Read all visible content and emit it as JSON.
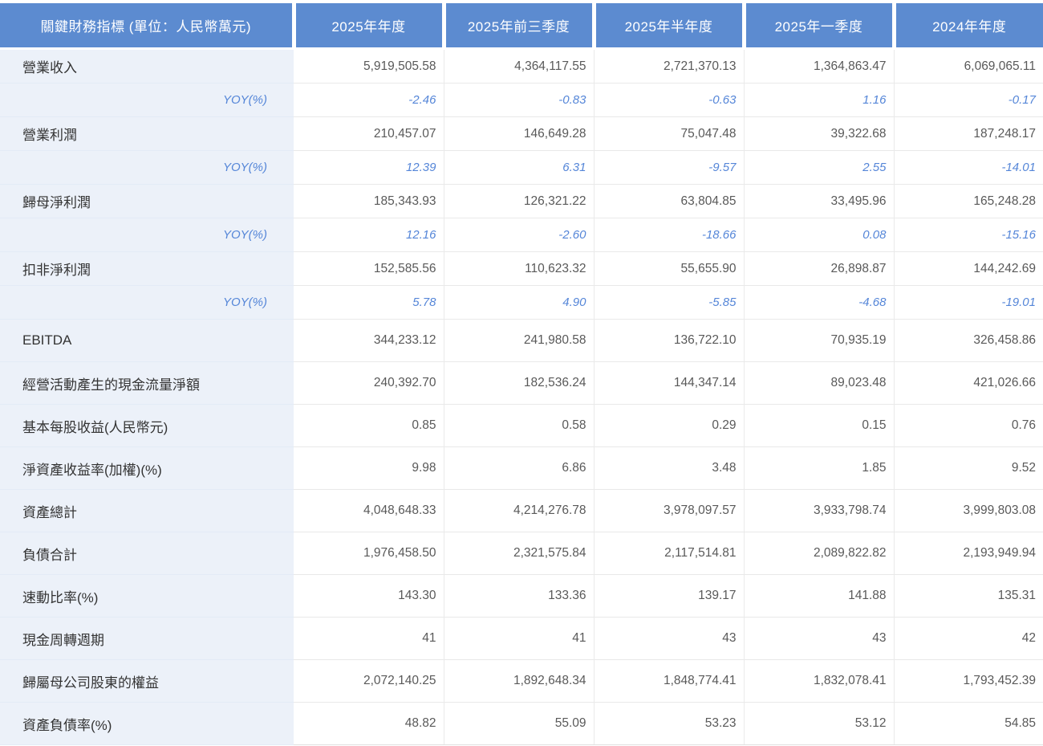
{
  "colors": {
    "header_bg": "#5C8BD0",
    "header_text": "#FFFFFF",
    "label_column_bg": "#ECF1F9",
    "label_text": "#333333",
    "value_text": "#595959",
    "yoy_text": "#5586D8",
    "grid_line": "#E9E9E9"
  },
  "chart_data": {
    "type": "table",
    "title": "關鍵財務指標 (單位：人民幣萬元)",
    "columns": [
      "2025年年度",
      "2025年前三季度",
      "2025年半年度",
      "2025年一季度",
      "2024年年度"
    ],
    "rows": [
      {
        "label": "營業收入",
        "kind": "metric",
        "values": [
          5919505.58,
          4364117.55,
          2721370.13,
          1364863.47,
          6069065.11
        ],
        "display": [
          "5,919,505.58",
          "4,364,117.55",
          "2,721,370.13",
          "1,364,863.47",
          "6,069,065.11"
        ]
      },
      {
        "label": "YOY(%)",
        "kind": "yoy",
        "values": [
          -2.46,
          -0.83,
          -0.63,
          1.16,
          -0.17
        ],
        "display": [
          "-2.46",
          "-0.83",
          "-0.63",
          "1.16",
          "-0.17"
        ]
      },
      {
        "label": "營業利潤",
        "kind": "metric",
        "values": [
          210457.07,
          146649.28,
          75047.48,
          39322.68,
          187248.17
        ],
        "display": [
          "210,457.07",
          "146,649.28",
          "75,047.48",
          "39,322.68",
          "187,248.17"
        ]
      },
      {
        "label": "YOY(%)",
        "kind": "yoy",
        "values": [
          12.39,
          6.31,
          -9.57,
          2.55,
          -14.01
        ],
        "display": [
          "12.39",
          "6.31",
          "-9.57",
          "2.55",
          "-14.01"
        ]
      },
      {
        "label": "歸母淨利潤",
        "kind": "metric",
        "values": [
          185343.93,
          126321.22,
          63804.85,
          33495.96,
          165248.28
        ],
        "display": [
          "185,343.93",
          "126,321.22",
          "63,804.85",
          "33,495.96",
          "165,248.28"
        ]
      },
      {
        "label": "YOY(%)",
        "kind": "yoy",
        "values": [
          12.16,
          -2.6,
          -18.66,
          0.08,
          -15.16
        ],
        "display": [
          "12.16",
          "-2.60",
          "-18.66",
          "0.08",
          "-15.16"
        ]
      },
      {
        "label": "扣非淨利潤",
        "kind": "metric",
        "values": [
          152585.56,
          110623.32,
          55655.9,
          26898.87,
          144242.69
        ],
        "display": [
          "152,585.56",
          "110,623.32",
          "55,655.90",
          "26,898.87",
          "144,242.69"
        ]
      },
      {
        "label": "YOY(%)",
        "kind": "yoy",
        "values": [
          5.78,
          4.9,
          -5.85,
          -4.68,
          -19.01
        ],
        "display": [
          "5.78",
          "4.90",
          "-5.85",
          "-4.68",
          "-19.01"
        ]
      },
      {
        "label": "EBITDA",
        "kind": "metric",
        "values": [
          344233.12,
          241980.58,
          136722.1,
          70935.19,
          326458.86
        ],
        "display": [
          "344,233.12",
          "241,980.58",
          "136,722.10",
          "70,935.19",
          "326,458.86"
        ]
      },
      {
        "label": "經營活動產生的現金流量淨額",
        "kind": "metric",
        "values": [
          240392.7,
          182536.24,
          144347.14,
          89023.48,
          421026.66
        ],
        "display": [
          "240,392.70",
          "182,536.24",
          "144,347.14",
          "89,023.48",
          "421,026.66"
        ]
      },
      {
        "label": "基本每股收益(人民幣元)",
        "kind": "metric",
        "values": [
          0.85,
          0.58,
          0.29,
          0.15,
          0.76
        ],
        "display": [
          "0.85",
          "0.58",
          "0.29",
          "0.15",
          "0.76"
        ]
      },
      {
        "label": "淨資產收益率(加權)(%)",
        "kind": "metric",
        "values": [
          9.98,
          6.86,
          3.48,
          1.85,
          9.52
        ],
        "display": [
          "9.98",
          "6.86",
          "3.48",
          "1.85",
          "9.52"
        ]
      },
      {
        "label": "資產總計",
        "kind": "metric",
        "values": [
          4048648.33,
          4214276.78,
          3978097.57,
          3933798.74,
          3999803.08
        ],
        "display": [
          "4,048,648.33",
          "4,214,276.78",
          "3,978,097.57",
          "3,933,798.74",
          "3,999,803.08"
        ]
      },
      {
        "label": "負債合計",
        "kind": "metric",
        "values": [
          1976458.5,
          2321575.84,
          2117514.81,
          2089822.82,
          2193949.94
        ],
        "display": [
          "1,976,458.50",
          "2,321,575.84",
          "2,117,514.81",
          "2,089,822.82",
          "2,193,949.94"
        ]
      },
      {
        "label": "速動比率(%)",
        "kind": "metric",
        "values": [
          143.3,
          133.36,
          139.17,
          141.88,
          135.31
        ],
        "display": [
          "143.30",
          "133.36",
          "139.17",
          "141.88",
          "135.31"
        ]
      },
      {
        "label": "現金周轉週期",
        "kind": "metric",
        "values": [
          41,
          41,
          43,
          43,
          42
        ],
        "display": [
          "41",
          "41",
          "43",
          "43",
          "42"
        ]
      },
      {
        "label": "歸屬母公司股東的權益",
        "kind": "metric",
        "values": [
          2072140.25,
          1892648.34,
          1848774.41,
          1832078.41,
          1793452.39
        ],
        "display": [
          "2,072,140.25",
          "1,892,648.34",
          "1,848,774.41",
          "1,832,078.41",
          "1,793,452.39"
        ]
      },
      {
        "label": "資產負債率(%)",
        "kind": "metric",
        "values": [
          48.82,
          55.09,
          53.23,
          53.12,
          54.85
        ],
        "display": [
          "48.82",
          "55.09",
          "53.23",
          "53.12",
          "54.85"
        ]
      }
    ]
  }
}
